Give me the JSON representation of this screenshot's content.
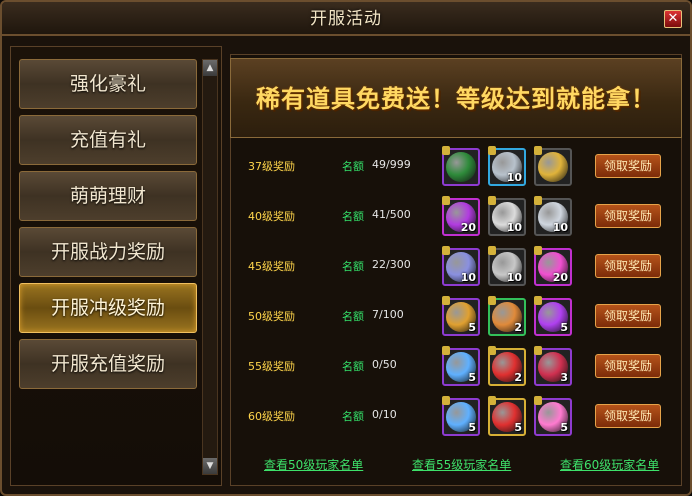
{
  "window": {
    "title": "开服活动",
    "close_symbol": "✕"
  },
  "sidebar": {
    "items": [
      {
        "label": "强化豪礼"
      },
      {
        "label": "充值有礼"
      },
      {
        "label": "萌萌理财"
      },
      {
        "label": "开服战力奖励"
      },
      {
        "label": "开服冲级奖励"
      },
      {
        "label": "开服充值奖励"
      }
    ],
    "active_index": 4,
    "scroll_up": "▲",
    "scroll_down": "▼"
  },
  "banner": {
    "text": "稀有道具免费送！等级达到就能拿！"
  },
  "rewards": [
    {
      "level": "37级奖励",
      "quota_label": "名额",
      "quota": "49/999",
      "items": [
        {
          "name": "box-icon",
          "count": "",
          "color": "#8e3bd0"
        },
        {
          "name": "silver-pile-icon",
          "count": "10",
          "color": "#32a8e0"
        },
        {
          "name": "gold-coins-icon",
          "count": "",
          "color": "#555"
        }
      ],
      "button": "领取奖励"
    },
    {
      "level": "40级奖励",
      "quota_label": "名额",
      "quota": "41/500",
      "items": [
        {
          "name": "purple-orb-icon",
          "count": "20",
          "color": "#c030d0"
        },
        {
          "name": "silver-ore-icon",
          "count": "10",
          "color": "#555"
        },
        {
          "name": "diamond-ore-icon",
          "count": "10",
          "color": "#555"
        }
      ],
      "button": "领取奖励"
    },
    {
      "level": "45级奖励",
      "quota_label": "名额",
      "quota": "22/300",
      "items": [
        {
          "name": "silver-ring-icon",
          "count": "10",
          "color": "#8e3bd0"
        },
        {
          "name": "ore-bowl-icon",
          "count": "10",
          "color": "#555"
        },
        {
          "name": "pink-orb-icon",
          "count": "20",
          "color": "#c030d0"
        }
      ],
      "button": "领取奖励"
    },
    {
      "level": "50级奖励",
      "quota_label": "名额",
      "quota": "7/100",
      "items": [
        {
          "name": "scroll-icon",
          "count": "5",
          "color": "#8e3bd0"
        },
        {
          "name": "crystal-icon",
          "count": "2",
          "color": "#33c05a"
        },
        {
          "name": "flame-icon",
          "count": "5",
          "color": "#c030d0"
        }
      ],
      "button": "领取奖励"
    },
    {
      "level": "55级奖励",
      "quota_label": "名额",
      "quota": "0/50",
      "items": [
        {
          "name": "wing-icon",
          "count": "5",
          "color": "#8e3bd0"
        },
        {
          "name": "gift-bag-icon",
          "count": "2",
          "color": "#d7b036"
        },
        {
          "name": "red-figure-icon",
          "count": "3",
          "color": "#8e3bd0"
        }
      ],
      "button": "领取奖励"
    },
    {
      "level": "60级奖励",
      "quota_label": "名额",
      "quota": "0/10",
      "items": [
        {
          "name": "wing-icon",
          "count": "5",
          "color": "#8e3bd0"
        },
        {
          "name": "gift-bag-icon",
          "count": "5",
          "color": "#d7b036"
        },
        {
          "name": "pink-wings-icon",
          "count": "5",
          "color": "#8e3bd0"
        }
      ],
      "button": "领取奖励"
    }
  ],
  "footer": {
    "links": [
      "查看50级玩家名单",
      "查看55级玩家名单",
      "查看60级玩家名单"
    ]
  },
  "colors": {
    "accent": "#ffd862",
    "level_text": "#ffd54b",
    "quota_text": "#34e16a",
    "link": "#3ee16a"
  }
}
